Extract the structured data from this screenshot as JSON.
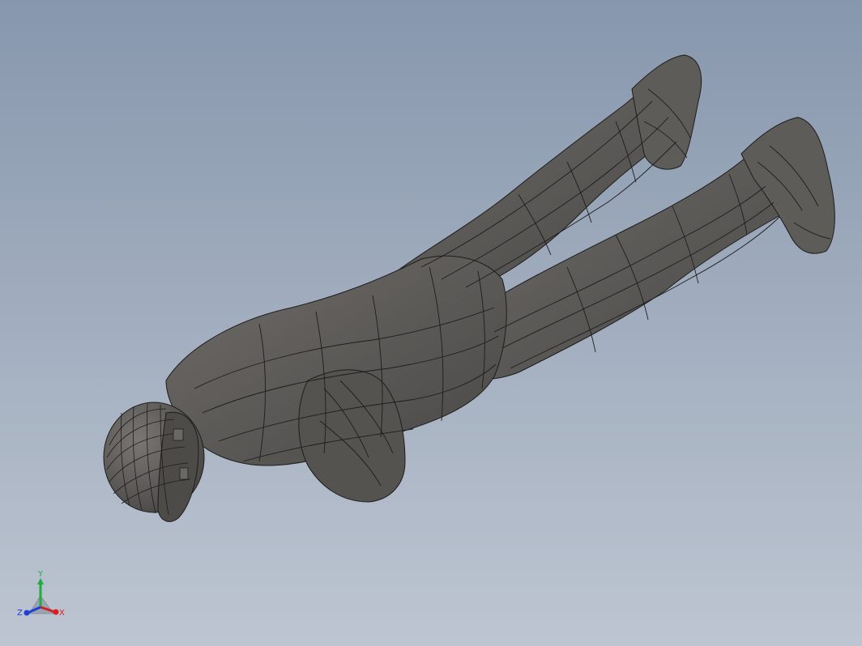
{
  "viewport": {
    "background_top": "#8797ad",
    "background_bottom": "#bdc5d1",
    "model_fill": "#5a5855",
    "model_edge": "#1e1d1c",
    "model_highlight": "#7b7874"
  },
  "triad": {
    "x_label": "X",
    "y_label": "Y",
    "z_label": "Z",
    "x_color": "#d81e1e",
    "y_color": "#1fae3a",
    "z_color": "#1e3fd8"
  }
}
